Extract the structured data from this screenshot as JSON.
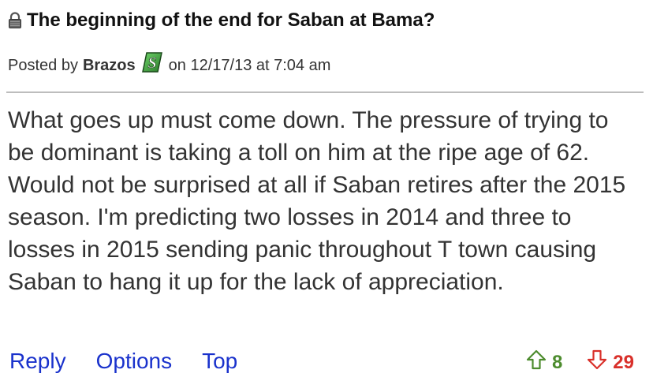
{
  "post": {
    "title": "The beginning of the end for Saban at Bama?",
    "meta": {
      "posted_by_label": "Posted by",
      "author": "Brazos",
      "date_text": "on 12/17/13 at 7:04 am"
    },
    "body": "What goes up must come down. The pressure of trying to be dominant is taking a toll on him at the ripe age of 62. Would not be surprised at all if Saban retires after the 2015 season. I'm predicting two losses in 2014 and three to losses in 2015 sending panic throughout T town causing Saban to hang it up for the lack of appreciation.",
    "actions": {
      "reply": "Reply",
      "options": "Options",
      "top": "Top"
    },
    "votes": {
      "up": "8",
      "down": "29"
    }
  },
  "icons": {
    "lock": "lock-icon",
    "author_badge": "author-badge-icon",
    "upvote": "upvote-arrow-icon",
    "downvote": "downvote-arrow-icon"
  },
  "colors": {
    "link": "#1a32cc",
    "upvote": "#4d8c2e",
    "downvote": "#d9302a",
    "divider": "#bdbdbd"
  }
}
